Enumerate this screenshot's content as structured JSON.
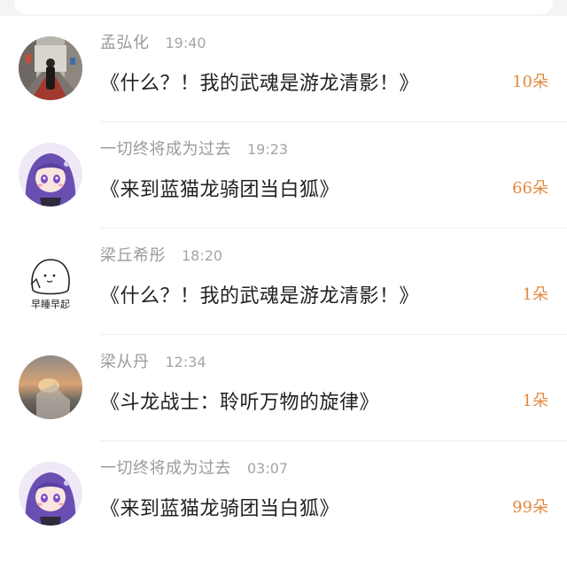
{
  "messages": [
    {
      "name": "孟弘化",
      "time": "19:40",
      "title": "《什么？！我的武魂是游龙清影！》",
      "count": "10朵",
      "avatar": "street-photo-avatar"
    },
    {
      "name": "一切终将成为过去",
      "time": "19:23",
      "title": "《来到蓝猫龙骑团当白狐》",
      "count": "66朵",
      "avatar": "anime-girl-avatar"
    },
    {
      "name": "梁丘希彤",
      "time": "18:20",
      "title": "《什么？！我的武魂是游龙清影！》",
      "count": "1朵",
      "avatar": "doodle-avatar",
      "avatar_caption": "早睡早起"
    },
    {
      "name": "梁从丹",
      "time": "12:34",
      "title": "《斗龙战士：聆听万物的旋律》",
      "count": "1朵",
      "avatar": "sunset-photo-avatar"
    },
    {
      "name": "一切终将成为过去",
      "time": "03:07",
      "title": "《来到蓝猫龙骑团当白狐》",
      "count": "99朵",
      "avatar": "anime-girl-avatar"
    }
  ],
  "colors": {
    "count": "#e2893e",
    "name": "#9b9b9b",
    "title": "#222222"
  }
}
